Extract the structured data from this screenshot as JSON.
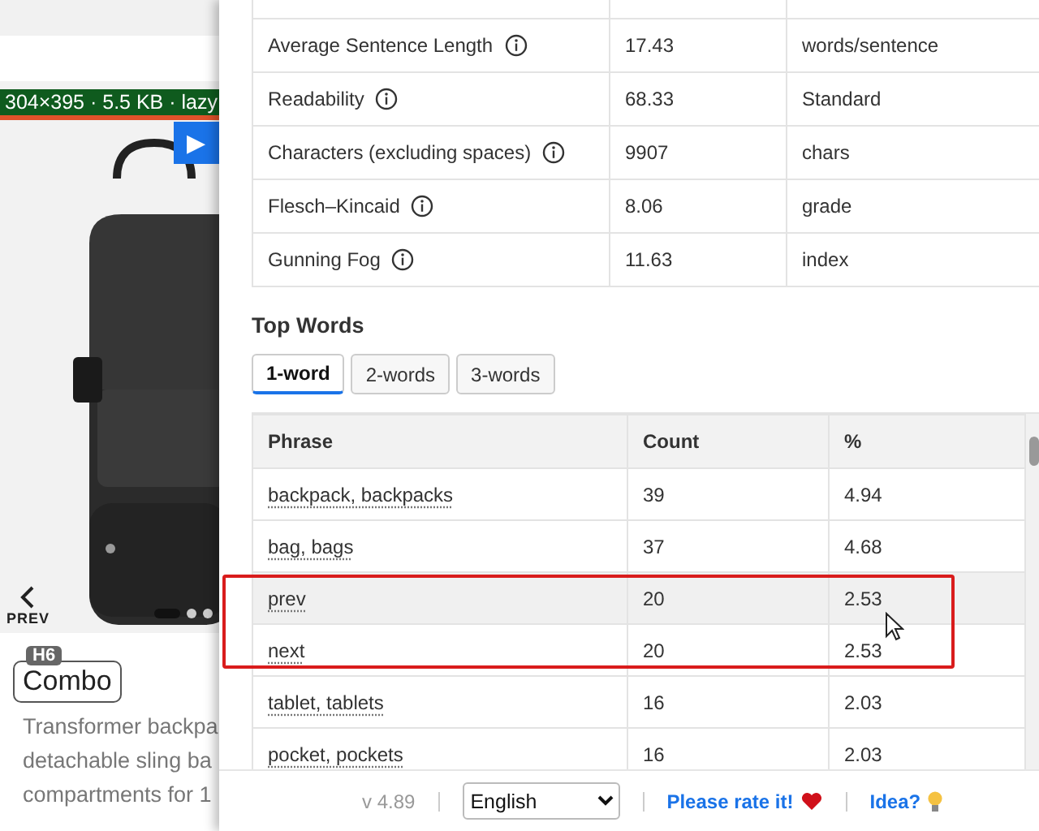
{
  "page": {
    "image_label": "304×395 · 5.5 KB · lazy",
    "play": "▶",
    "prev": "PREV",
    "dots": [
      {
        "selected": true
      },
      {
        "selected": false
      },
      {
        "selected": false
      }
    ],
    "heading_tag": "H6",
    "heading": "Combo",
    "description": [
      "Transformer backpa",
      "detachable sling ba",
      "compartments for 1"
    ]
  },
  "metrics": [
    {
      "label": "Average Sentence Length",
      "value": "17.43",
      "unit": "words/sentence"
    },
    {
      "label": "Readability",
      "value": "68.33",
      "unit": "Standard"
    },
    {
      "label": "Characters (excluding spaces)",
      "value": "9907",
      "unit": "chars"
    },
    {
      "label": "Flesch–Kincaid",
      "value": "8.06",
      "unit": "grade"
    },
    {
      "label": "Gunning Fog",
      "value": "11.63",
      "unit": "index"
    }
  ],
  "top_words": {
    "title": "Top Words",
    "tabs": [
      {
        "label": "1-word",
        "selected": true
      },
      {
        "label": "2-words",
        "selected": false
      },
      {
        "label": "3-words",
        "selected": false
      }
    ],
    "columns": [
      "Phrase",
      "Count",
      "%"
    ],
    "rows": [
      {
        "phrase": "backpack, backpacks",
        "count": "39",
        "percent": "4.94",
        "hovered": false
      },
      {
        "phrase": "bag, bags",
        "count": "37",
        "percent": "4.68",
        "hovered": false
      },
      {
        "phrase": "prev",
        "count": "20",
        "percent": "2.53",
        "hovered": true
      },
      {
        "phrase": "next",
        "count": "20",
        "percent": "2.53",
        "hovered": false
      },
      {
        "phrase": "tablet, tablets",
        "count": "16",
        "percent": "2.03",
        "hovered": false
      },
      {
        "phrase": "pocket, pockets",
        "count": "16",
        "percent": "2.03",
        "hovered": false
      }
    ]
  },
  "footer": {
    "version": "v 4.89",
    "language": "English",
    "rate_link": "Please rate it!",
    "idea_link": "Idea?"
  }
}
